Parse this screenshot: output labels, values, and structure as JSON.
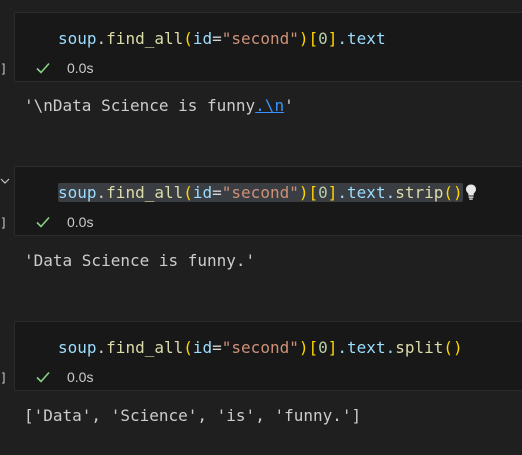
{
  "cells": [
    {
      "bracket": "]",
      "code": {
        "var": "soup",
        "dot1": ".",
        "fn": "find_all",
        "paren_open": "(",
        "kw": "id",
        "eq": "=",
        "str": "\"second\"",
        "paren_close": ")",
        "bracket_open": "[",
        "index": "0",
        "bracket_close": "]",
        "tail": ".text"
      },
      "status": "0.0s",
      "output_plain": "'\\nData Science is funny",
      "output_link": ".\\n",
      "output_end": "'"
    },
    {
      "chevron": "chevron-down",
      "bracket": "]",
      "code": {
        "var": "soup",
        "dot1": ".",
        "fn": "find_all",
        "paren_open": "(",
        "kw": "id",
        "eq": "=",
        "str": "\"second\"",
        "paren_close": ")",
        "bracket_open": "[",
        "index": "0",
        "bracket_close": "]",
        "mid": ".text.",
        "fn2": "strip",
        "call": "()"
      },
      "status": "0.0s",
      "output": "'Data Science is funny.'"
    },
    {
      "bracket": "]",
      "code": {
        "var": "soup",
        "dot1": ".",
        "fn": "find_all",
        "paren_open": "(",
        "kw": "id",
        "eq": "=",
        "str": "\"second\"",
        "paren_close": ")",
        "bracket_open": "[",
        "index": "0",
        "bracket_close": "]",
        "mid": ".text.",
        "fn2": "split",
        "call": "()"
      },
      "status": "0.0s",
      "output": "['Data', 'Science', 'is', 'funny.']"
    }
  ],
  "colors": {
    "background": "#1f1f1f",
    "success": "#89d185",
    "link": "#3794ff"
  }
}
